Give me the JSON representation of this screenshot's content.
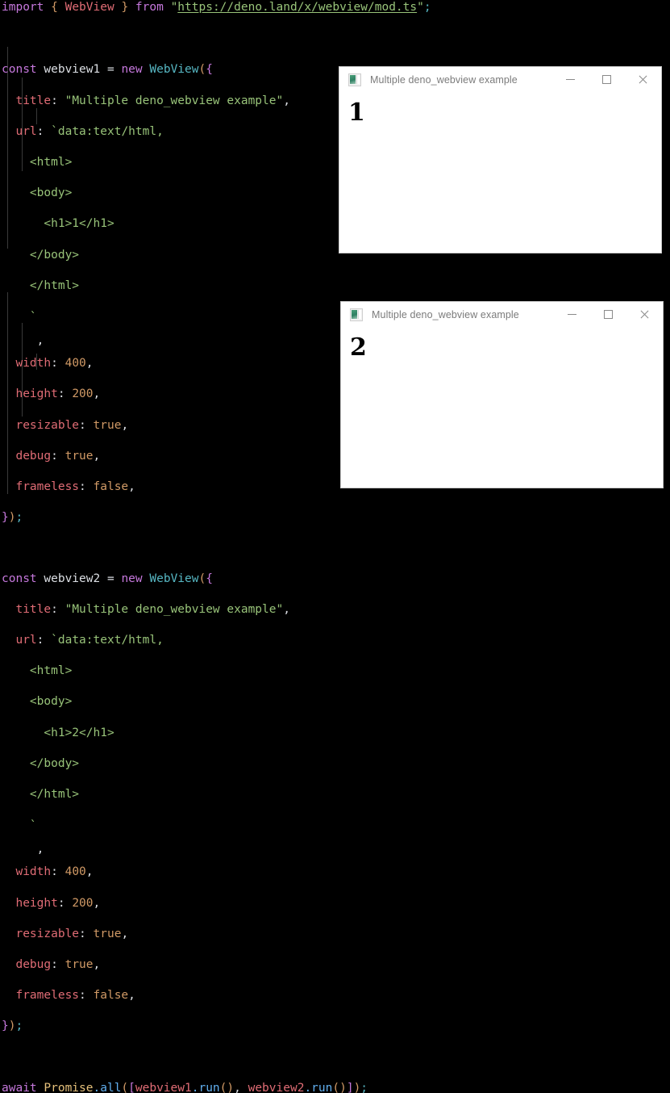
{
  "editor": {
    "background": "#000000",
    "foreground": "#dcdfe4",
    "lines": {
      "l1_import": "import",
      "l1_brace_open": "{",
      "l1_webview": "WebView",
      "l1_brace_close": "}",
      "l1_from": "from",
      "l1_quote": "\"",
      "l1_url": "https://deno.land/x/webview/mod.ts",
      "l1_quote_end": "\"",
      "l1_semi": ";",
      "const_kw": "const",
      "new_kw": "new",
      "class_name": "WebView",
      "paren_open": "({",
      "var1": "webview1",
      "var2": "webview2",
      "equals": "=",
      "prop_title": "title",
      "val_title": "\"Multiple deno_webview example\"",
      "prop_url": "url",
      "val_url_tick": "`data:text/html,",
      "html_open": "<html>",
      "body_open": "<body>",
      "h1_one": "<h1>1</h1>",
      "h1_two": "<h1>2</h1>",
      "body_close": "</body>",
      "html_close": "</html>",
      "tick_close": "`",
      "tick_comma": ",",
      "prop_width": "width",
      "val_width": "400",
      "prop_height": "height",
      "val_height": "200",
      "prop_resizable": "resizable",
      "val_resizable": "true",
      "prop_debug": "debug",
      "val_debug": "true",
      "prop_frameless": "frameless",
      "val_frameless": "false",
      "comma": ",",
      "colon": ":",
      "close_curly": "}",
      "close_paren": ")",
      "close_semi": ";",
      "await_kw": "await",
      "promise_obj": "Promise",
      "dot_all": ".all",
      "call_open": "([",
      "run_var1": "webview1",
      "run_dot": ".run",
      "run_parens": "()",
      "run_sep": ", ",
      "run_var2": "webview2",
      "call_close": "])",
      "final_semi": ";"
    },
    "token_colors": {
      "keyword": "#c678dd",
      "string": "#98c379",
      "property": "#e06c75",
      "number": "#d19a66",
      "class": "#56b6c2",
      "function": "#61afef",
      "object": "#e5c07b",
      "plain": "#dcdfe4"
    }
  },
  "windows": [
    {
      "id": "webview-window-1",
      "title": "Multiple deno_webview example",
      "icon": "app-window-icon",
      "content_heading": "1",
      "controls": {
        "minimize": "—",
        "maximize": "☐",
        "close": "✕"
      }
    },
    {
      "id": "webview-window-2",
      "title": "Multiple deno_webview example",
      "icon": "app-window-icon",
      "content_heading": "2",
      "controls": {
        "minimize": "—",
        "maximize": "☐",
        "close": "✕"
      }
    }
  ]
}
